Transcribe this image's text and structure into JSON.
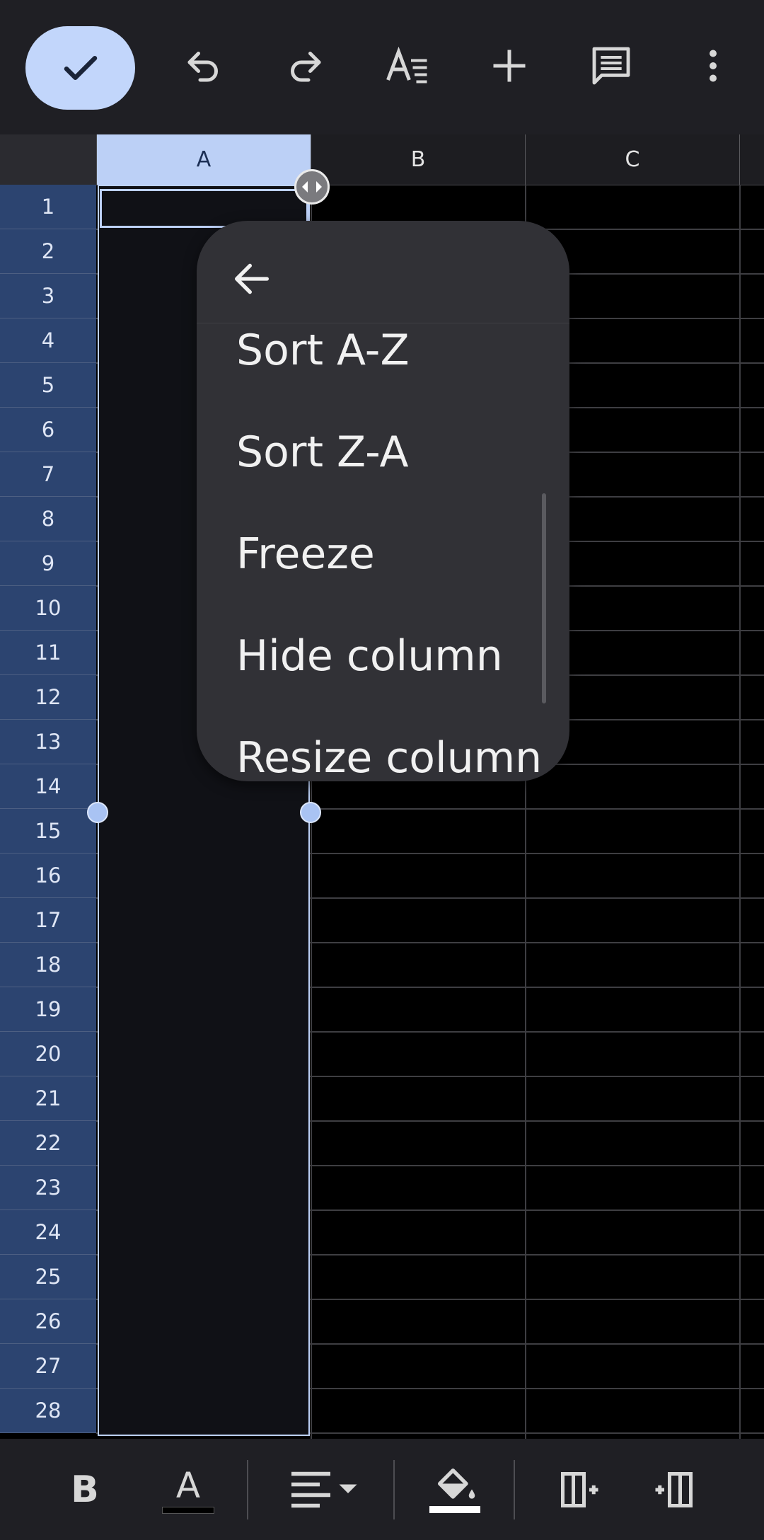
{
  "toolbar": {
    "icons": [
      "check-icon",
      "undo-icon",
      "redo-icon",
      "text-format-icon",
      "add-icon",
      "comment-icon",
      "more-vert-icon"
    ]
  },
  "columns": [
    "A",
    "B",
    "C"
  ],
  "rows": [
    "1",
    "2",
    "3",
    "4",
    "5",
    "6",
    "7",
    "8",
    "9",
    "10",
    "11",
    "12",
    "13",
    "14",
    "15",
    "16",
    "17",
    "18",
    "19",
    "20",
    "21",
    "22",
    "23",
    "24",
    "25",
    "26",
    "27",
    "28"
  ],
  "menu": {
    "items": [
      "Sort A-Z",
      "Sort Z-A",
      "Freeze",
      "Hide column",
      "Resize column"
    ]
  },
  "bottom_toolbar": {
    "bold_label": "B",
    "text_color_label": "A",
    "icons": [
      "bold-icon",
      "text-color-icon",
      "align-icon",
      "fill-color-icon",
      "insert-column-left-icon",
      "insert-column-right-icon"
    ]
  },
  "colors": {
    "accent": "#c2d6fb",
    "row_header": "#2c4470",
    "menu_bg": "#313136"
  }
}
